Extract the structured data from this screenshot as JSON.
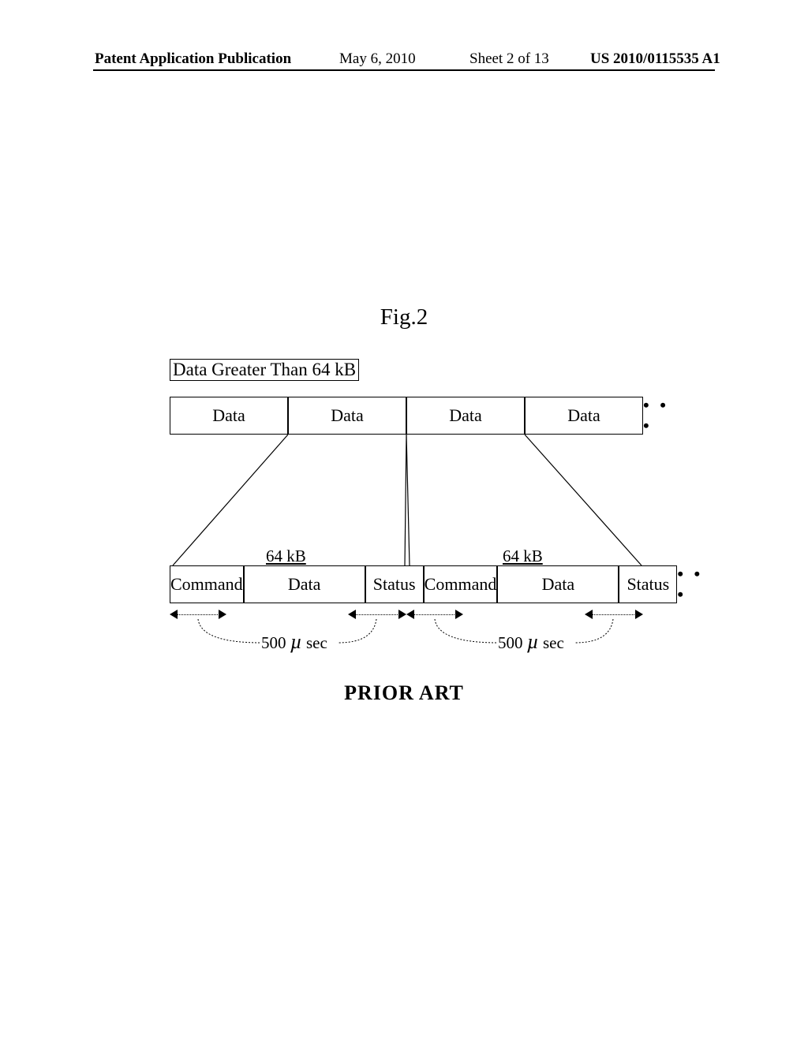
{
  "header": {
    "left": "Patent Application Publication",
    "date": "May 6, 2010",
    "sheet": "Sheet 2 of 13",
    "pubno": "US 2010/0115535 A1"
  },
  "figure_label": "Fig.2",
  "caption": "Data Greater Than 64 kB",
  "prior_art": "PRIOR ART",
  "top_row": {
    "cells": [
      "Data",
      "Data",
      "Data",
      "Data"
    ],
    "ellipsis": "• • •"
  },
  "bot_row": {
    "seq": [
      "Command",
      "Data",
      "Status",
      "Command",
      "Data",
      "Status"
    ],
    "ellipsis": "• • •"
  },
  "kb_label": "64 kB",
  "usec": {
    "value": "500",
    "mu": "µ",
    "unit": "sec"
  }
}
